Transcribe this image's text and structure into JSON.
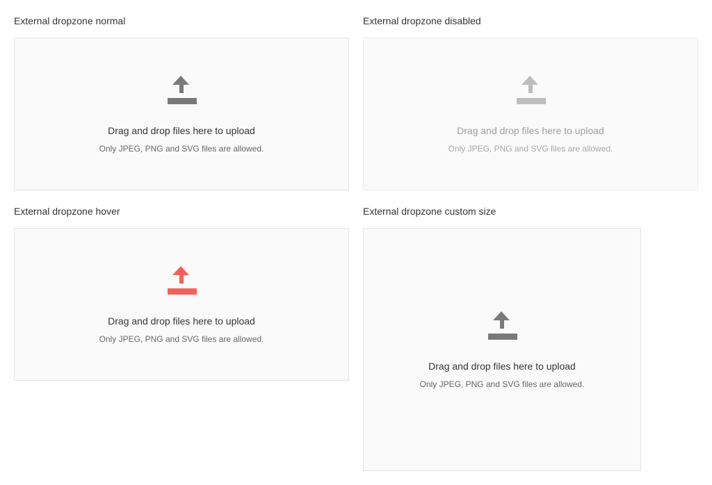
{
  "colors": {
    "icon_normal": "#7a7a7a",
    "icon_disabled": "#bdbdbd",
    "icon_hover": "#f2605a",
    "dropzone_background": "#fafafa",
    "dropzone_border": "#e3e3e3"
  },
  "dropzones": [
    {
      "label": "External dropzone normal",
      "state": "normal",
      "icon": "upload-icon",
      "title": "Drag and drop files here to upload",
      "hint": "Only JPEG, PNG and SVG files are allowed."
    },
    {
      "label": "External dropzone disabled",
      "state": "disabled",
      "icon": "upload-icon",
      "title": "Drag and drop files here to upload",
      "hint": "Only JPEG, PNG and SVG files are allowed."
    },
    {
      "label": "External dropzone hover",
      "state": "hover",
      "icon": "upload-icon",
      "title": "Drag and drop files here to upload",
      "hint": "Only JPEG, PNG and SVG files are allowed."
    },
    {
      "label": "External dropzone custom size",
      "state": "normal",
      "icon": "upload-icon",
      "title": "Drag and drop files here to upload",
      "hint": "Only JPEG, PNG and SVG files are allowed."
    }
  ]
}
